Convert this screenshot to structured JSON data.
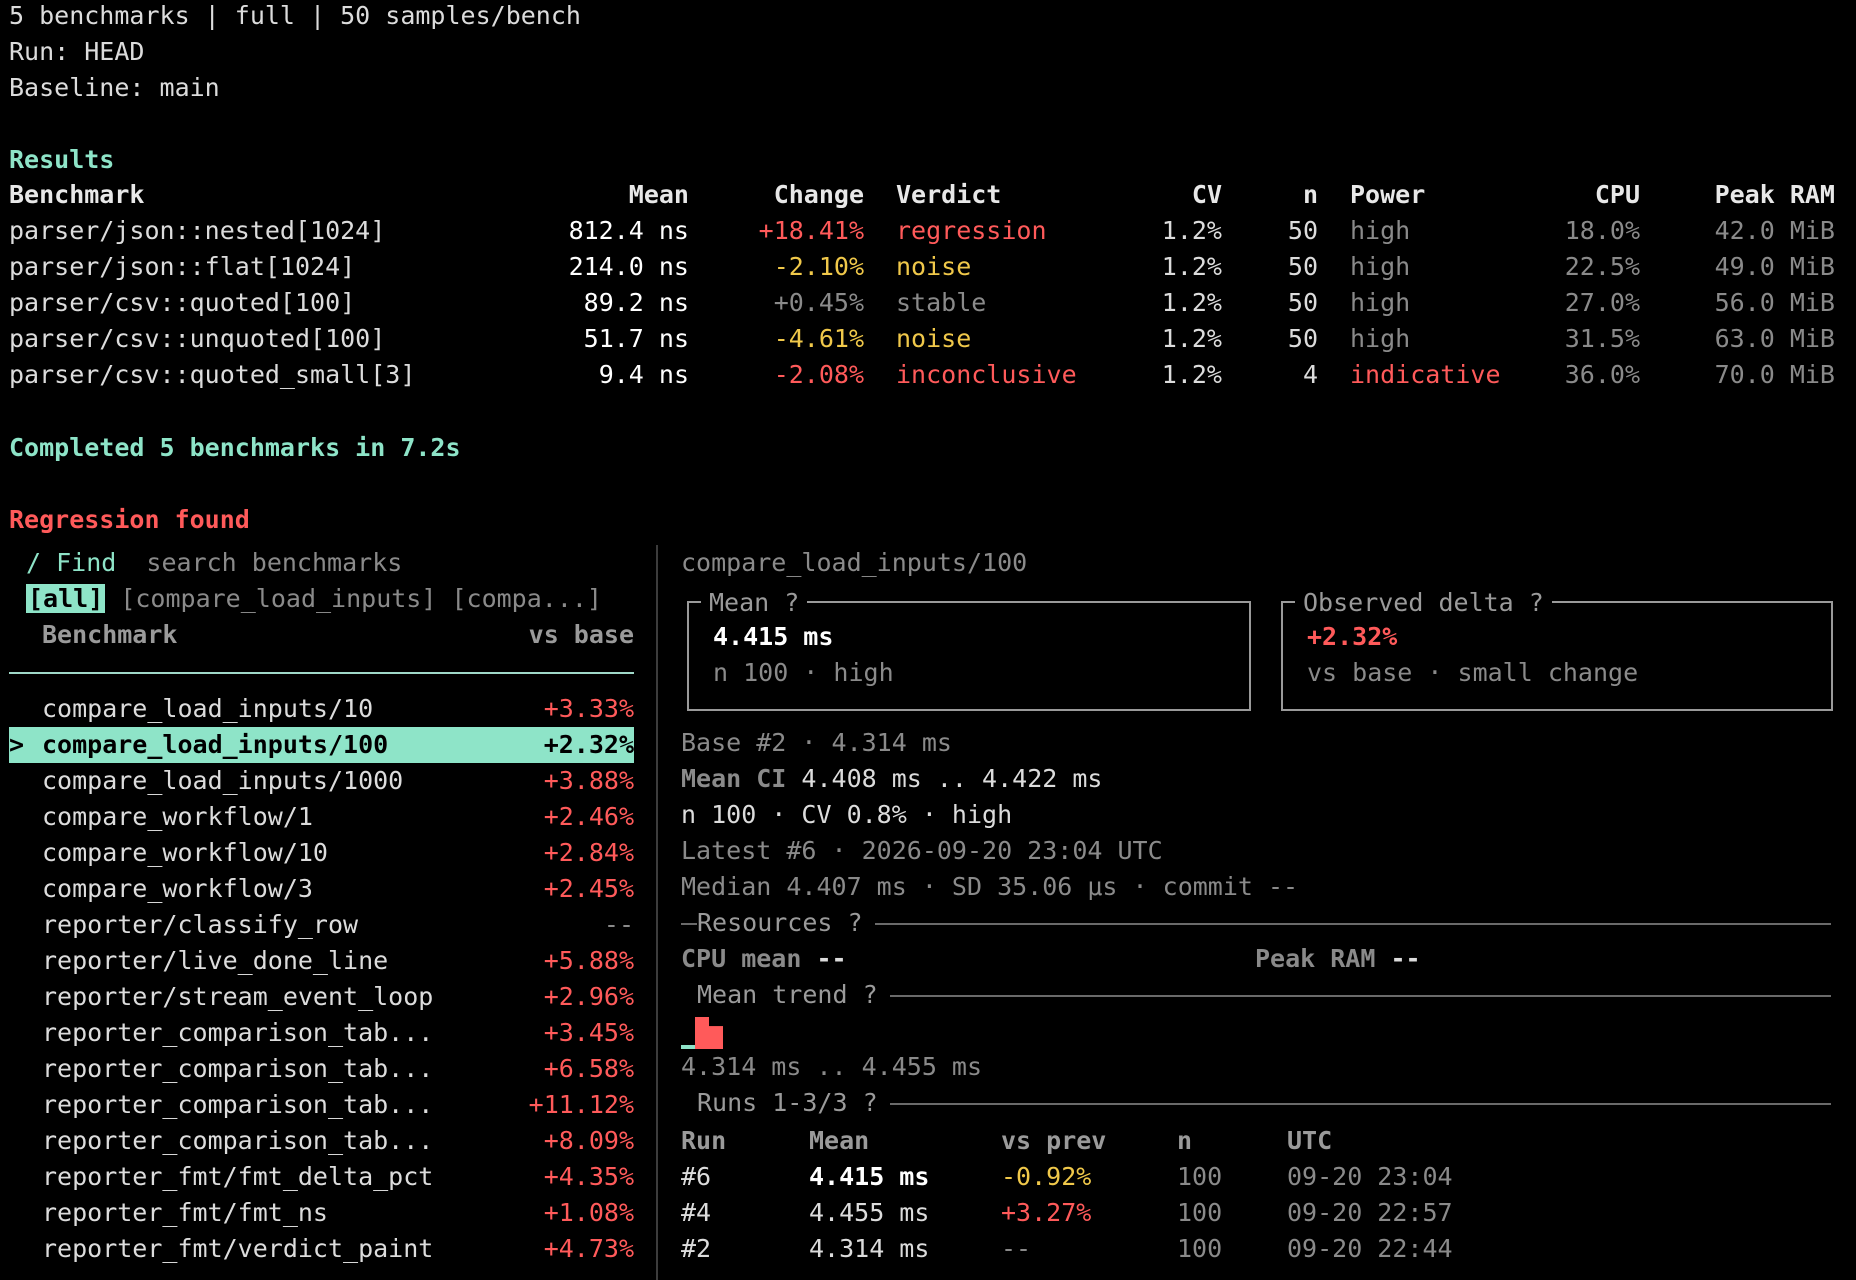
{
  "header": {
    "summary": "5 benchmarks | full | 50 samples/bench",
    "run": "Run: HEAD",
    "baseline": "Baseline: main"
  },
  "results": {
    "title": "Results",
    "columns": [
      "Benchmark",
      "Mean",
      "Change",
      "Verdict",
      "CV",
      "n",
      "Power",
      "CPU",
      "Peak RAM"
    ],
    "rows": [
      {
        "benchmark": "parser/json::nested[1024]",
        "mean": "812.4 ns",
        "change": "+18.41%",
        "verdict": "regression",
        "cv": "1.2%",
        "n": "50",
        "power": "high",
        "cpu": "18.0%",
        "peak_ram": "42.0 MiB"
      },
      {
        "benchmark": "parser/json::flat[1024]",
        "mean": "214.0 ns",
        "change": "-2.10%",
        "verdict": "noise",
        "cv": "1.2%",
        "n": "50",
        "power": "high",
        "cpu": "22.5%",
        "peak_ram": "49.0 MiB"
      },
      {
        "benchmark": "parser/csv::quoted[100]",
        "mean": "89.2 ns",
        "change": "+0.45%",
        "verdict": "stable",
        "cv": "1.2%",
        "n": "50",
        "power": "high",
        "cpu": "27.0%",
        "peak_ram": "56.0 MiB"
      },
      {
        "benchmark": "parser/csv::unquoted[100]",
        "mean": "51.7 ns",
        "change": "-4.61%",
        "verdict": "noise",
        "cv": "1.2%",
        "n": "50",
        "power": "high",
        "cpu": "31.5%",
        "peak_ram": "63.0 MiB"
      },
      {
        "benchmark": "parser/csv::quoted_small[3]",
        "mean": "9.4 ns",
        "change": "-2.08%",
        "verdict": "inconclusive",
        "cv": "1.2%",
        "n": "4",
        "power": "indicative",
        "cpu": "36.0%",
        "peak_ram": "70.0 MiB"
      }
    ],
    "completed": "Completed 5 benchmarks in 7.2s",
    "status": "Regression found"
  },
  "browser": {
    "find_label": "/ Find",
    "find_placeholder": "search benchmarks",
    "filters": [
      "[all]",
      "[compare_load_inputs]",
      "[compa...]"
    ],
    "col_benchmark": "Benchmark",
    "col_vs_base": "vs base",
    "selected_marker": ">",
    "items": [
      {
        "name": "compare_load_inputs/10",
        "delta": "+3.33%"
      },
      {
        "name": "compare_load_inputs/100",
        "delta": "+2.32%"
      },
      {
        "name": "compare_load_inputs/1000",
        "delta": "+3.88%"
      },
      {
        "name": "compare_workflow/1",
        "delta": "+2.46%"
      },
      {
        "name": "compare_workflow/10",
        "delta": "+2.84%"
      },
      {
        "name": "compare_workflow/3",
        "delta": "+2.45%"
      },
      {
        "name": "reporter/classify_row",
        "delta": "--"
      },
      {
        "name": "reporter/live_done_line",
        "delta": "+5.88%"
      },
      {
        "name": "reporter/stream_event_loop",
        "delta": "+2.96%"
      },
      {
        "name": "reporter_comparison_tab...",
        "delta": "+3.45%"
      },
      {
        "name": "reporter_comparison_tab...",
        "delta": "+6.58%"
      },
      {
        "name": "reporter_comparison_tab...",
        "delta": "+11.12%"
      },
      {
        "name": "reporter_comparison_tab...",
        "delta": "+8.09%"
      },
      {
        "name": "reporter_fmt/fmt_delta_pct",
        "delta": "+4.35%"
      },
      {
        "name": "reporter_fmt/fmt_ns",
        "delta": "+1.08%"
      },
      {
        "name": "reporter_fmt/verdict_paint",
        "delta": "+4.73%"
      }
    ]
  },
  "detail": {
    "title": "compare_load_inputs/100",
    "mean_box": {
      "title": "Mean ?",
      "value": "4.415 ms",
      "sub": "n 100 · high"
    },
    "delta_box": {
      "title": "Observed delta ?",
      "value": "+2.32%",
      "sub": "vs base · small change"
    },
    "base": "Base #2 · 4.314 ms",
    "mean_ci_label": "Mean CI",
    "mean_ci_value": "4.408 ms .. 4.422 ms",
    "n_line": "n 100 · CV 0.8% · high",
    "latest": "Latest #6 · 2026-09-20 23:04 UTC",
    "median": "Median 4.407 ms · SD 35.06 μs · commit --",
    "resources_label": "Resources ?",
    "cpu_mean_label": "CPU mean",
    "cpu_mean_value": "--",
    "peak_ram_label": "Peak RAM",
    "peak_ram_value": "--",
    "trend_label": "Mean trend ?",
    "trend_values": [
      4.314,
      4.455,
      4.415
    ],
    "trend_range": "4.314 ms .. 4.455 ms",
    "runs_label": "Runs 1-3/3 ?",
    "runs_columns": [
      "Run",
      "Mean",
      "vs prev",
      "n",
      "UTC"
    ],
    "runs": [
      {
        "run": "#6",
        "mean": "4.415 ms",
        "vs_prev": "-0.92%",
        "n": "100",
        "utc": "09-20 23:04"
      },
      {
        "run": "#4",
        "mean": "4.455 ms",
        "vs_prev": "+3.27%",
        "n": "100",
        "utc": "09-20 22:57"
      },
      {
        "run": "#2",
        "mean": "4.314 ms",
        "vs_prev": "--",
        "n": "100",
        "utc": "09-20 22:44"
      }
    ]
  },
  "colors": {
    "accent": "#8ee4c8",
    "regression": "#ff5a5a",
    "noise": "#f0c84a"
  }
}
